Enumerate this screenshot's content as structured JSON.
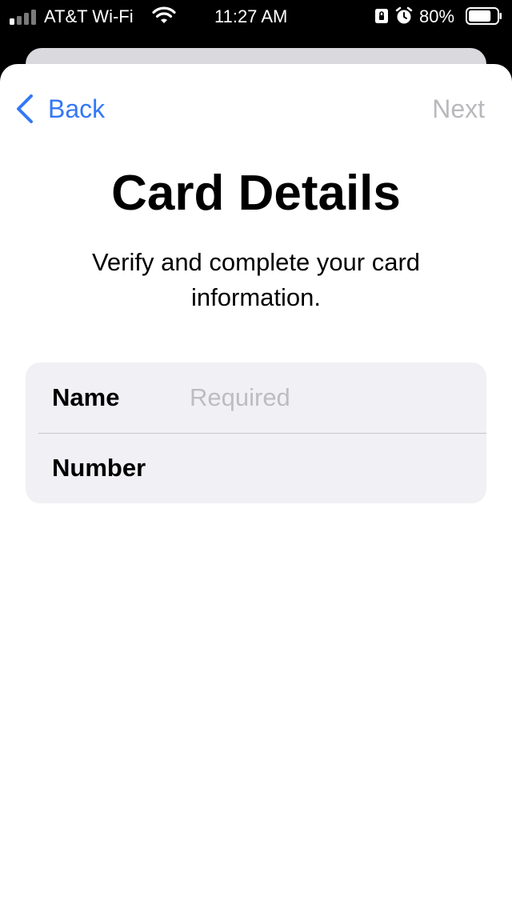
{
  "status_bar": {
    "carrier": "AT&T Wi-Fi",
    "time": "11:27 AM",
    "battery_percent": "80%",
    "battery_level": 0.8,
    "signal_bars_active": 1,
    "icons": [
      "signal-icon",
      "wifi-icon",
      "orientation-lock-icon",
      "alarm-icon",
      "battery-icon"
    ]
  },
  "nav": {
    "back_label": "Back",
    "next_label": "Next",
    "accent_color": "#3478f6",
    "disabled_color": "#b9b9bd"
  },
  "page": {
    "title": "Card Details",
    "subtitle": "Verify and complete your card information."
  },
  "form": {
    "fields": [
      {
        "label": "Name",
        "value": "",
        "placeholder": "Required"
      },
      {
        "label": "Number",
        "value": "",
        "placeholder": ""
      }
    ]
  }
}
